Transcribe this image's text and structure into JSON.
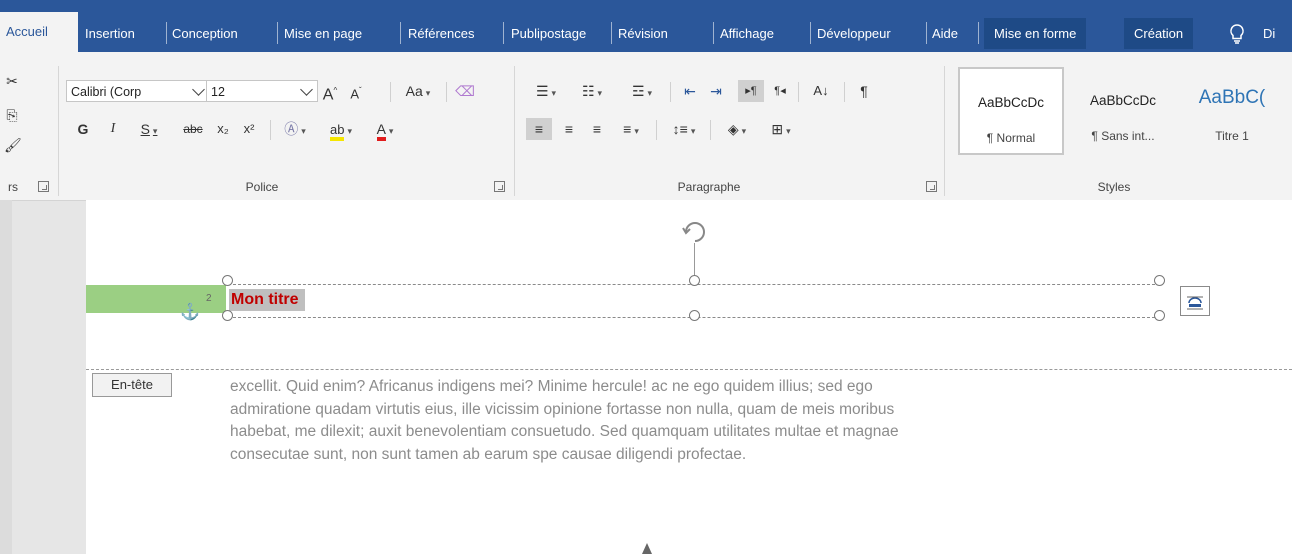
{
  "tabs": [
    {
      "label": "Accueil",
      "active": true
    },
    {
      "label": "Insertion"
    },
    {
      "label": "Conception"
    },
    {
      "label": "Mise en page"
    },
    {
      "label": "Références"
    },
    {
      "label": "Publipostage"
    },
    {
      "label": "Révision"
    },
    {
      "label": "Affichage"
    },
    {
      "label": "Développeur"
    },
    {
      "label": "Aide"
    },
    {
      "label": "Mise en forme",
      "contextual": true
    },
    {
      "label": "Création",
      "contextual": true
    },
    {
      "label": "Di"
    }
  ],
  "ribbon": {
    "clipboard_label": "rs",
    "font": {
      "group_label": "Police",
      "font_name": "Calibri (Corp",
      "font_size": "12",
      "grow": "A",
      "shrink": "A",
      "case": "Aa",
      "bold": "G",
      "italic": "I",
      "underline": "S",
      "strike": "abc",
      "subscript": "x₂",
      "superscript": "x²",
      "font_color": "A"
    },
    "paragraph": {
      "group_label": "Paragraphe",
      "sort": "A↓",
      "pilcrow": "¶"
    },
    "styles": {
      "group_label": "Styles",
      "items": [
        {
          "sample": "AaBbCcDc",
          "name": "¶ Normal"
        },
        {
          "sample": "AaBbCcDc",
          "name": "¶ Sans int..."
        },
        {
          "sample": "AaBbC(",
          "name": "Titre 1"
        }
      ]
    }
  },
  "document": {
    "title": "Mon titre",
    "anchor_number": "2",
    "header_label": "En-tête",
    "body_lines": [
      "excellit. Quid enim? Africanus indigens mei? Minime hercule! ac ne ego quidem illius; sed ego",
      "admiratione quadam virtutis eius, ille vicissim opinione fortasse non nulla, quam de meis moribus",
      "habebat, me dilexit; auxit benevolentiam consuetudo. Sed quamquam utilitates multae et magnae",
      "consecutae sunt, non sunt tamen ab earum spe causae diligendi profectae."
    ]
  },
  "colors": {
    "accent": "#2b579a",
    "title_red": "#c00000",
    "header_green": "#9bcf83"
  }
}
